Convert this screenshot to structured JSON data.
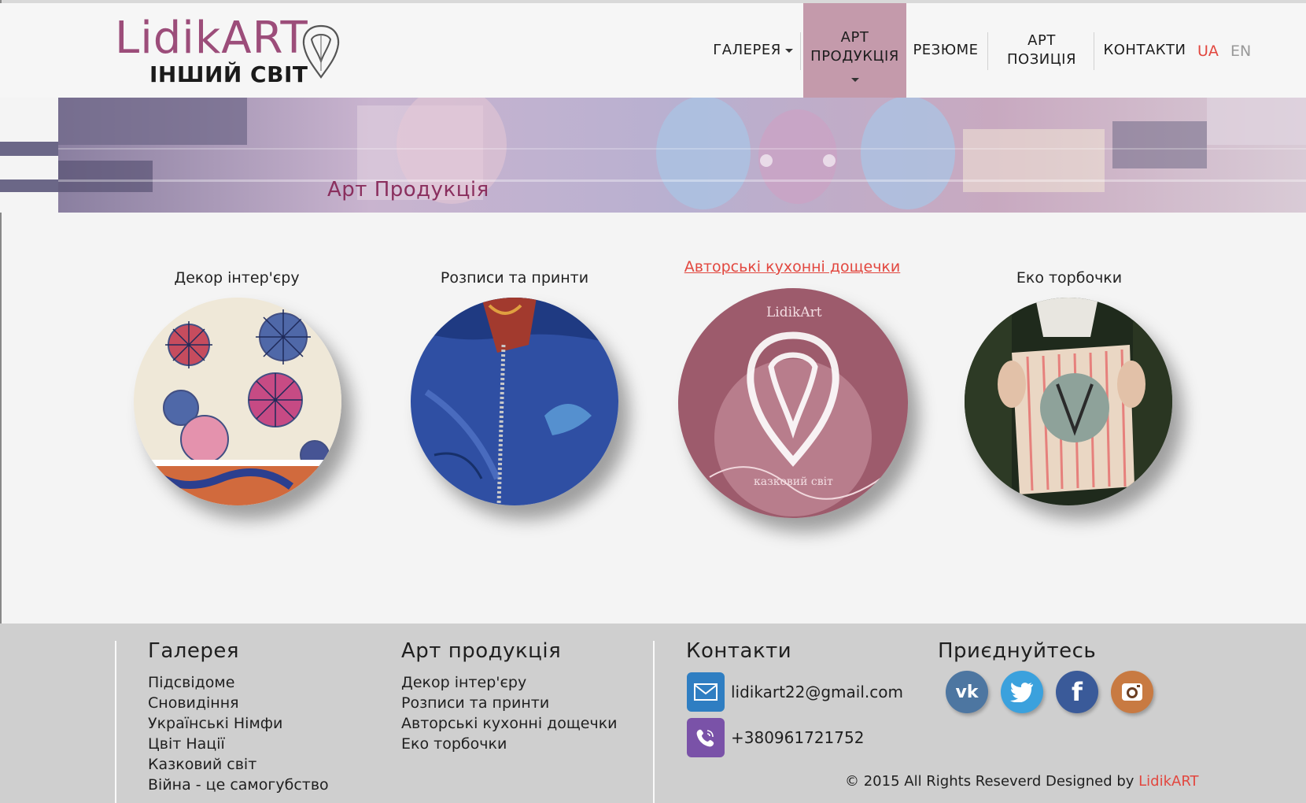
{
  "logo": {
    "title": "LidikART",
    "subtitle": "ІНШИЙ СВІТ"
  },
  "nav": {
    "items": [
      {
        "label": "ГАЛЕРЕЯ"
      },
      {
        "label_line1": "АРТ",
        "label_line2": "ПРОДУКЦІЯ"
      },
      {
        "label": "РЕЗЮМЕ"
      },
      {
        "label_line1": "АРТ",
        "label_line2": "ПОЗИЦІЯ"
      },
      {
        "label": "КОНТАКТИ"
      }
    ],
    "lang_active": "UA",
    "lang_other": "EN"
  },
  "banner": {
    "title": "Арт Продукція"
  },
  "products": [
    {
      "title": "Декор інтер'єру"
    },
    {
      "title": "Розписи та принти"
    },
    {
      "title": "Авторські кухонні дощечки",
      "watermark": "LidikArt",
      "caption": "казковий світ"
    },
    {
      "title": "Еко торбочки"
    }
  ],
  "footer": {
    "gallery": {
      "title": "Галерея",
      "items": [
        "Підсвідоме",
        "Сновидіння",
        "Українські Німфи",
        "Цвіт Нації",
        "Казковий світ",
        "Війна - це самогубство"
      ]
    },
    "art": {
      "title": "Арт продукція",
      "items": [
        "Декор інтер'єру",
        "Розписи та принти",
        "Авторські кухонні дощечки",
        "Еко торбочки"
      ]
    },
    "contacts": {
      "title": "Контакти",
      "email": "lidikart22@gmail.com",
      "phone": "+380961721752",
      "icons": [
        "mail-icon",
        "viber-icon"
      ]
    },
    "join": {
      "title": "Приєднуйтесь",
      "icons": [
        "vk-icon",
        "twitter-icon",
        "facebook-icon",
        "instagram-icon"
      ]
    },
    "copyright_prefix": "© 2015 All Rights Reseverd Designed by",
    "copyright_brand": "LidikART"
  },
  "colors": {
    "accent": "#9c4d7a",
    "active_nav": "#c49aab",
    "link_red": "#e2473f",
    "footer_bg": "#cfcfcf"
  }
}
